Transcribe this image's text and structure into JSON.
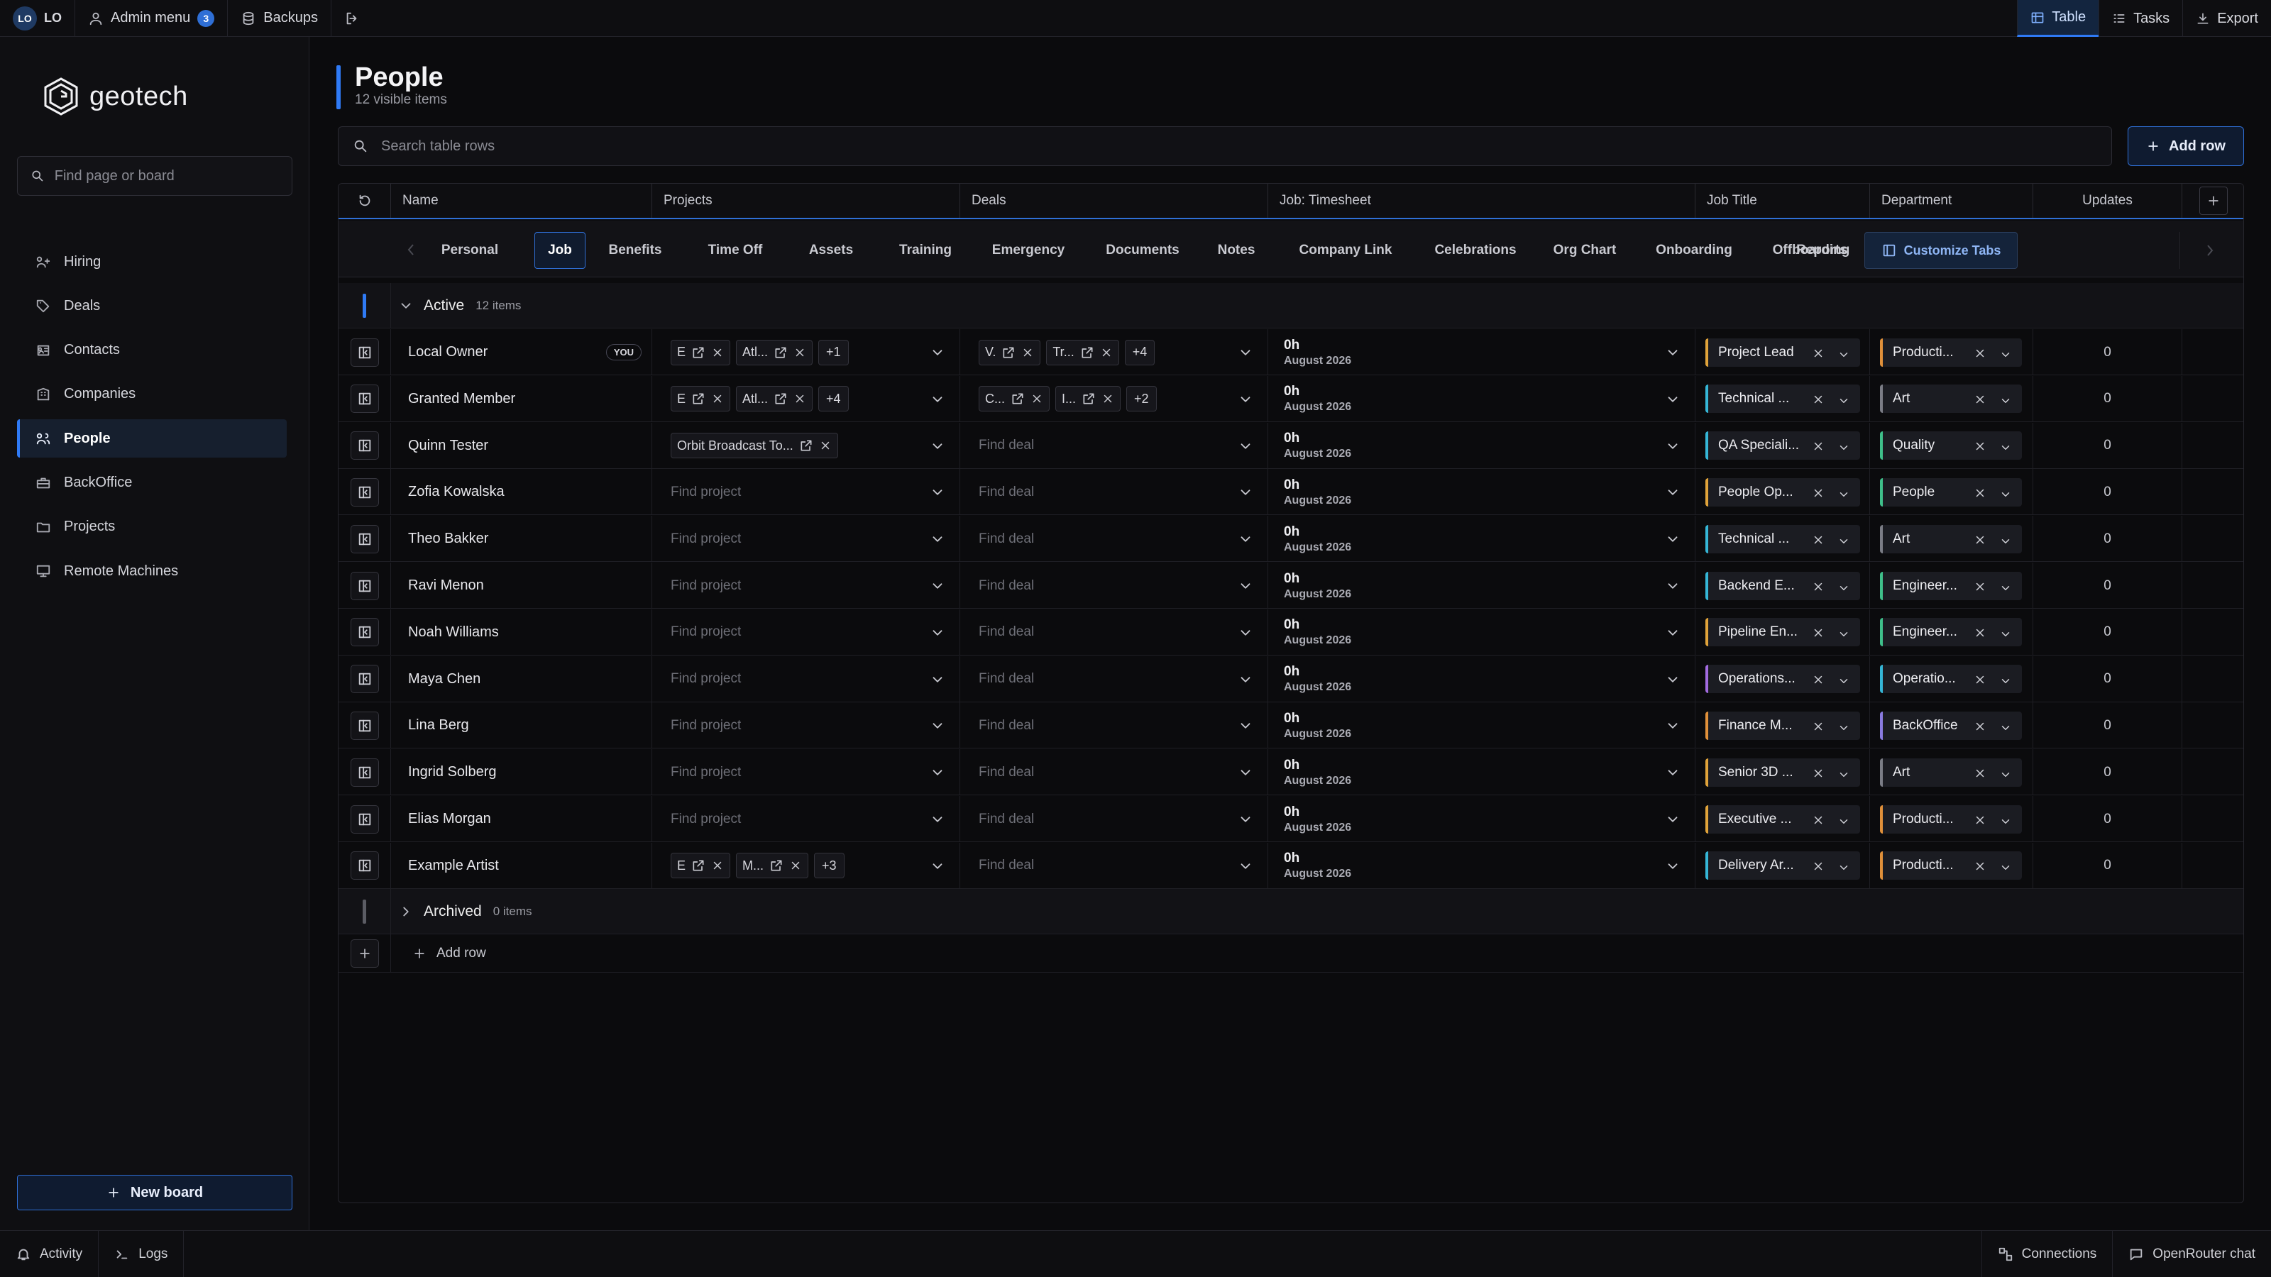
{
  "topbar": {
    "avatar": "LO",
    "user": "LO",
    "admin_menu": "Admin menu",
    "admin_count": "3",
    "backups": "Backups",
    "right": [
      {
        "label": "Table",
        "icon": "table-icon",
        "active": true
      },
      {
        "label": "Tasks",
        "icon": "tasks-icon",
        "active": false
      },
      {
        "label": "Export",
        "icon": "download-icon",
        "active": false
      }
    ]
  },
  "sidebar": {
    "logo_text": "geotech",
    "search_placeholder": "Find page or board",
    "items": [
      {
        "label": "Hiring",
        "icon": "user-plus-icon"
      },
      {
        "label": "Deals",
        "icon": "tag-icon"
      },
      {
        "label": "Contacts",
        "icon": "contact-card-icon"
      },
      {
        "label": "Companies",
        "icon": "building-icon"
      },
      {
        "label": "People",
        "icon": "users-icon",
        "active": true
      },
      {
        "label": "BackOffice",
        "icon": "briefcase-icon"
      },
      {
        "label": "Projects",
        "icon": "folder-icon"
      },
      {
        "label": "Remote Machines",
        "icon": "monitor-icon"
      }
    ],
    "new_board": "New board"
  },
  "bottombar": {
    "activity": "Activity",
    "logs": "Logs",
    "connections": "Connections",
    "chat": "OpenRouter chat"
  },
  "main": {
    "title": "People",
    "subtitle": "12 visible items",
    "search_placeholder": "Search table rows",
    "add_row_button": "Add row",
    "columns": [
      "Name",
      "Projects",
      "Deals",
      "Job: Timesheet",
      "Job Title",
      "Department",
      "Updates"
    ],
    "tabs": [
      "Personal",
      "Job",
      "Benefits",
      "Time Off",
      "Assets",
      "Training",
      "Emergency",
      "Documents",
      "Notes",
      "Company Link",
      "Celebrations",
      "Org Chart",
      "Onboarding",
      "Offboarding",
      "Reports"
    ],
    "active_tab": "Job",
    "customize_tabs": "Customize Tabs",
    "groups": {
      "active": {
        "label": "Active",
        "count": "12 items"
      },
      "archived": {
        "label": "Archived",
        "count": "0 items"
      }
    },
    "project_placeholder": "Find project",
    "deal_placeholder": "Find deal",
    "you_badge": "YOU",
    "add_row_footer": "Add row",
    "rows": [
      {
        "name": "Local Owner",
        "you": true,
        "projects": [
          "E",
          "Atl..."
        ],
        "projects_more": "+1",
        "deals": [
          "V.",
          "Tr..."
        ],
        "deals_more": "+4",
        "hours": "0h",
        "date": "August 2026",
        "job_title": "Project Lead",
        "job_color": "#e0a33a",
        "department": "Producti...",
        "dept_color": "#e0903a",
        "updates": "0"
      },
      {
        "name": "Granted Member",
        "projects": [
          "E",
          "Atl..."
        ],
        "projects_more": "+4",
        "deals": [
          "C...",
          "I..."
        ],
        "deals_more": "+2",
        "hours": "0h",
        "date": "August 2026",
        "job_title": "Technical ...",
        "job_color": "#35b6d6",
        "department": "Art",
        "dept_color": "#7b7d86",
        "updates": "0"
      },
      {
        "name": "Quinn Tester",
        "projects": [
          "Orbit Broadcast To..."
        ],
        "projects_more": "",
        "deals": [],
        "deals_more": "",
        "hours": "0h",
        "date": "August 2026",
        "job_title": "QA Speciali...",
        "job_color": "#35b6d6",
        "department": "Quality",
        "dept_color": "#3fbf8a",
        "updates": "0"
      },
      {
        "name": "Zofia Kowalska",
        "projects": [],
        "projects_more": "",
        "deals": [],
        "deals_more": "",
        "hours": "0h",
        "date": "August 2026",
        "job_title": "People Op...",
        "job_color": "#e0a33a",
        "department": "People",
        "dept_color": "#3fbf8a",
        "updates": "0"
      },
      {
        "name": "Theo Bakker",
        "projects": [],
        "projects_more": "",
        "deals": [],
        "deals_more": "",
        "hours": "0h",
        "date": "August 2026",
        "job_title": "Technical ...",
        "job_color": "#35b6d6",
        "department": "Art",
        "dept_color": "#7b7d86",
        "updates": "0"
      },
      {
        "name": "Ravi Menon",
        "projects": [],
        "projects_more": "",
        "deals": [],
        "deals_more": "",
        "hours": "0h",
        "date": "August 2026",
        "job_title": "Backend E...",
        "job_color": "#35b6d6",
        "department": "Engineer...",
        "dept_color": "#3fbf8a",
        "updates": "0"
      },
      {
        "name": "Noah Williams",
        "projects": [],
        "projects_more": "",
        "deals": [],
        "deals_more": "",
        "hours": "0h",
        "date": "August 2026",
        "job_title": "Pipeline En...",
        "job_color": "#e0a33a",
        "department": "Engineer...",
        "dept_color": "#3fbf8a",
        "updates": "0"
      },
      {
        "name": "Maya Chen",
        "projects": [],
        "projects_more": "",
        "deals": [],
        "deals_more": "",
        "hours": "0h",
        "date": "August 2026",
        "job_title": "Operations...",
        "job_color": "#a26be0",
        "department": "Operatio...",
        "dept_color": "#35b6d6",
        "updates": "0"
      },
      {
        "name": "Lina Berg",
        "projects": [],
        "projects_more": "",
        "deals": [],
        "deals_more": "",
        "hours": "0h",
        "date": "August 2026",
        "job_title": "Finance M...",
        "job_color": "#e0903a",
        "department": "BackOffice",
        "dept_color": "#8a7be0",
        "updates": "0"
      },
      {
        "name": "Ingrid Solberg",
        "projects": [],
        "projects_more": "",
        "deals": [],
        "deals_more": "",
        "hours": "0h",
        "date": "August 2026",
        "job_title": "Senior 3D ...",
        "job_color": "#e0a33a",
        "department": "Art",
        "dept_color": "#7b7d86",
        "updates": "0"
      },
      {
        "name": "Elias Morgan",
        "projects": [],
        "projects_more": "",
        "deals": [],
        "deals_more": "",
        "hours": "0h",
        "date": "August 2026",
        "job_title": "Executive ...",
        "job_color": "#e0a33a",
        "department": "Producti...",
        "dept_color": "#e0903a",
        "updates": "0"
      },
      {
        "name": "Example Artist",
        "projects": [
          "E",
          "M..."
        ],
        "projects_more": "+3",
        "deals": [],
        "deals_more": "",
        "hours": "0h",
        "date": "August 2026",
        "job_title": "Delivery Ar...",
        "job_color": "#35b6d6",
        "department": "Producti...",
        "dept_color": "#e0903a",
        "updates": "0"
      }
    ]
  }
}
